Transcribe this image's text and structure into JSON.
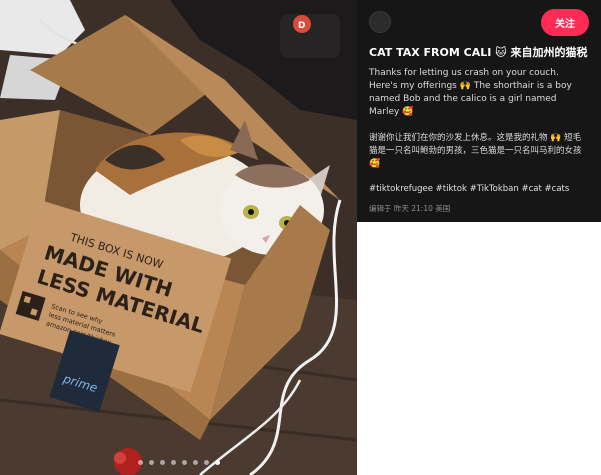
{
  "post": {
    "follow_label": "关注",
    "title": "CAT TAX FROM CALI 🐱 来自加州的猫税",
    "description_en_1": "Thanks for letting us crash on your couch. Here's my offerings",
    "description_en_emoji_1": "🙌",
    "description_en_2": "The shorthair is a boy named Bob and the calico is a girl named Marley",
    "description_en_emoji_2": "🥰",
    "description_zh_1": "谢谢你让我们在你的沙发上休息。这是我的礼物",
    "description_zh_emoji_1": "🙌",
    "description_zh_2": "短毛猫是一只名叫鲍勃的男孩，三色猫是一只名叫马利的女孩",
    "description_zh_emoji_2": "🥰",
    "hashtags": [
      "#tiktokrefugee",
      "#tiktok",
      "#TikTokban",
      "#cat",
      "#cats"
    ],
    "meta": "编辑于 昨天 21:10 美国"
  },
  "photo": {
    "box_print": [
      "THIS BOX IS NOW",
      "MADE WITH",
      "LESS MATERIAL"
    ],
    "box_small": [
      "Scan to see why",
      "less material matters",
      "amazon.com/thisbox"
    ],
    "prime_label": "prime"
  },
  "carousel": {
    "count": 8,
    "active_index": 7
  },
  "colors": {
    "accent": "#fe2c55",
    "panel_bg": "#161616"
  }
}
